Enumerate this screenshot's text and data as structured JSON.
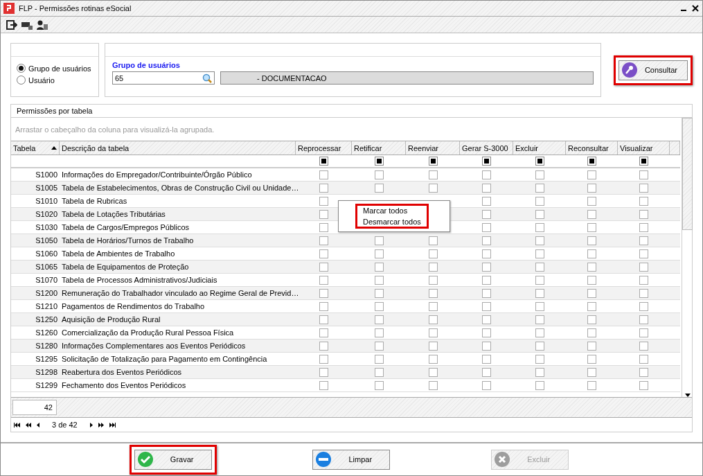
{
  "window": {
    "title": "FLP - Permissões rotinas eSocial"
  },
  "filter": {
    "options": [
      {
        "label": "Grupo de usuários",
        "selected": true
      },
      {
        "label": "Usuário",
        "selected": false
      }
    ],
    "group_label": "Grupo de usuários",
    "code": "65",
    "description": "- DOCUMENTACAO",
    "search_button": {
      "label": "Consultar",
      "highlighted": true
    }
  },
  "grid": {
    "title": "Permissões por tabela",
    "group_hint": "Arrastar o cabeçalho da coluna para visualizá-la agrupada.",
    "columns": [
      "Tabela",
      "Descrição da tabela",
      "Reprocessar",
      "Retificar",
      "Reenviar",
      "Gerar S-3000",
      "Excluir",
      "Reconsultar",
      "Visualizar"
    ],
    "header_checks": [
      true,
      true,
      true,
      true,
      true,
      true,
      true
    ],
    "rows": [
      {
        "kind": "full",
        "code": "S1000",
        "description": "Informações do Empregador/Contribuinte/Órgão Público",
        "checks": [
          false,
          false,
          false,
          false,
          false,
          false,
          false
        ]
      },
      {
        "kind": "full",
        "code": "S1005",
        "description": "Tabela de Estabelecimentos, Obras de Construção Civil ou Unidade…",
        "checks": [
          false,
          false,
          false,
          false,
          false,
          false,
          false
        ]
      },
      {
        "kind": "under_menu",
        "code": "S1010",
        "description": "Tabela de Rubricas",
        "checks": [
          false,
          false,
          false,
          false,
          false
        ]
      },
      {
        "kind": "under_menu",
        "code": "S1020",
        "description": "Tabela de Lotações Tributárias",
        "checks": [
          false,
          false,
          false,
          false,
          false
        ]
      },
      {
        "kind": "under_menu",
        "code": "S1030",
        "description": "Tabela de Cargos/Empregos Públicos",
        "checks": [
          false,
          false,
          false,
          false,
          false
        ]
      },
      {
        "kind": "full",
        "code": "S1050",
        "description": "Tabela de Horários/Turnos de Trabalho",
        "checks": [
          false,
          false,
          false,
          false,
          false,
          false,
          false
        ]
      },
      {
        "kind": "full",
        "code": "S1060",
        "description": "Tabela de Ambientes de Trabalho",
        "checks": [
          false,
          false,
          false,
          false,
          false,
          false,
          false
        ]
      },
      {
        "kind": "full",
        "code": "S1065",
        "description": "Tabela de Equipamentos de Proteção",
        "checks": [
          false,
          false,
          false,
          false,
          false,
          false,
          false
        ]
      },
      {
        "kind": "full",
        "code": "S1070",
        "description": "Tabela de Processos Administrativos/Judiciais",
        "checks": [
          false,
          false,
          false,
          false,
          false,
          false,
          false
        ]
      },
      {
        "kind": "full",
        "code": "S1200",
        "description": "Remuneração do Trabalhador vinculado ao Regime Geral de Previd…",
        "checks": [
          false,
          false,
          false,
          false,
          false,
          false,
          false
        ]
      },
      {
        "kind": "full",
        "code": "S1210",
        "description": "Pagamentos de Rendimentos do Trabalho",
        "checks": [
          false,
          false,
          false,
          false,
          false,
          false,
          false
        ]
      },
      {
        "kind": "full",
        "code": "S1250",
        "description": "Aquisição de Produção Rural",
        "checks": [
          false,
          false,
          false,
          false,
          false,
          false,
          false
        ]
      },
      {
        "kind": "full",
        "code": "S1260",
        "description": "Comercialização da Produção Rural Pessoa Física",
        "checks": [
          false,
          false,
          false,
          false,
          false,
          false,
          false
        ]
      },
      {
        "kind": "full",
        "code": "S1280",
        "description": "Informações Complementares aos Eventos Periódicos",
        "checks": [
          false,
          false,
          false,
          false,
          false,
          false,
          false
        ]
      },
      {
        "kind": "full",
        "code": "S1295",
        "description": "Solicitação de Totalização para Pagamento em Contingência",
        "checks": [
          false,
          false,
          false,
          false,
          false,
          false,
          false
        ]
      },
      {
        "kind": "full",
        "code": "S1298",
        "description": "Reabertura dos Eventos Periódicos",
        "checks": [
          false,
          false,
          false,
          false,
          false,
          false,
          false
        ]
      },
      {
        "kind": "full",
        "code": "S1299",
        "description": "Fechamento dos Eventos Periódicos",
        "checks": [
          false,
          false,
          false,
          false,
          false,
          false,
          false
        ]
      }
    ],
    "count": "42",
    "pager": "3 de 42"
  },
  "context_menu": {
    "items": [
      "Marcar todos",
      "Desmarcar todos"
    ],
    "highlighted": true
  },
  "buttons": [
    {
      "kind": "save",
      "label": "Gravar",
      "disabled": false,
      "highlighted": true
    },
    {
      "kind": "clear",
      "label": "Limpar",
      "disabled": false,
      "highlighted": false
    },
    {
      "kind": "delete",
      "label": "Excluir",
      "disabled": true,
      "highlighted": false
    }
  ]
}
